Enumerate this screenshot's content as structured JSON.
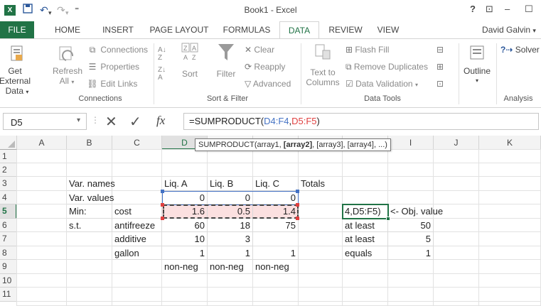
{
  "titlebar": {
    "app_icon": "X",
    "title": "Book1 - Excel",
    "help": "?",
    "restore_icon_label": "⊡",
    "minimize_label": "–",
    "maximize_label": "☐",
    "save_icon": "💾",
    "undo_icon": "↶",
    "redo_icon": "↷",
    "customize_icon": "⁼"
  },
  "tabs": [
    "FILE",
    "HOME",
    "INSERT",
    "PAGE LAYOUT",
    "FORMULAS",
    "DATA",
    "REVIEW",
    "VIEW"
  ],
  "user": "David Galvin",
  "ribbon": {
    "get_external": "Get External",
    "get_external_2": "Data",
    "refresh": "Refresh",
    "refresh_2": "All",
    "connections": "Connections",
    "properties": "Properties",
    "edit_links": "Edit Links",
    "sort": "Sort",
    "filter": "Filter",
    "clear": "Clear",
    "reapply": "Reapply",
    "advanced": "Advanced",
    "text_to": "Text to",
    "columns": "Columns",
    "flash_fill": "Flash Fill",
    "remove_duplicates": "Remove Duplicates",
    "data_validation": "Data Validation",
    "outline": "Outline",
    "solver": "Solver",
    "groups": {
      "connections": "Connections",
      "sort_filter": "Sort & Filter",
      "data_tools": "Data Tools",
      "analysis": "Analysis"
    }
  },
  "formula_bar": {
    "name_box": "D5",
    "formula_prefix": "=SUMPRODUCT(",
    "formula_ref1": "D4:F4",
    "formula_comma": ",",
    "formula_ref2": "D5:F5",
    "formula_suffix": ")",
    "tooltip_fn": "SUMPRODUCT(array1, ",
    "tooltip_bold": "[array2]",
    "tooltip_rest": ", [array3], [array4], ...)"
  },
  "columns": [
    "A",
    "B",
    "C",
    "D",
    "E",
    "F",
    "G",
    "H",
    "I",
    "J",
    "K"
  ],
  "rows": [
    "1",
    "2",
    "3",
    "4",
    "5",
    "6",
    "7",
    "8",
    "9",
    "10",
    "11"
  ],
  "cells": {
    "B3": "Var. names",
    "D3": "Liq. A",
    "E3": "Liq. B",
    "F3": "Liq. C",
    "G3": "Totals",
    "B4": "Var. values",
    "D4": "0",
    "E4": "0",
    "F4": "0",
    "B5": "Min:",
    "C5": "cost",
    "D5": "1.6",
    "E5": "0.5",
    "F5": "1.4",
    "H5": "4,D5:F5)",
    "I5": "<- Obj. value",
    "B6": "s.t.",
    "C6": "antifreeze",
    "D6": "60",
    "E6": "18",
    "F6": "75",
    "H6": "at least",
    "I6": "50",
    "C7": "additive",
    "D7": "10",
    "E7": "3",
    "H7": "at least",
    "I7": "5",
    "C8": "gallon",
    "D8": "1",
    "E8": "1",
    "F8": "1",
    "H8": "equals",
    "I8": "1",
    "D9": "non-neg",
    "E9": "non-neg",
    "F9": "non-neg"
  },
  "colors": {
    "excel_green": "#217346",
    "ref_blue": "#4472c4",
    "ref_red": "#e04040",
    "highlight_pink": "#fbe0e0"
  }
}
